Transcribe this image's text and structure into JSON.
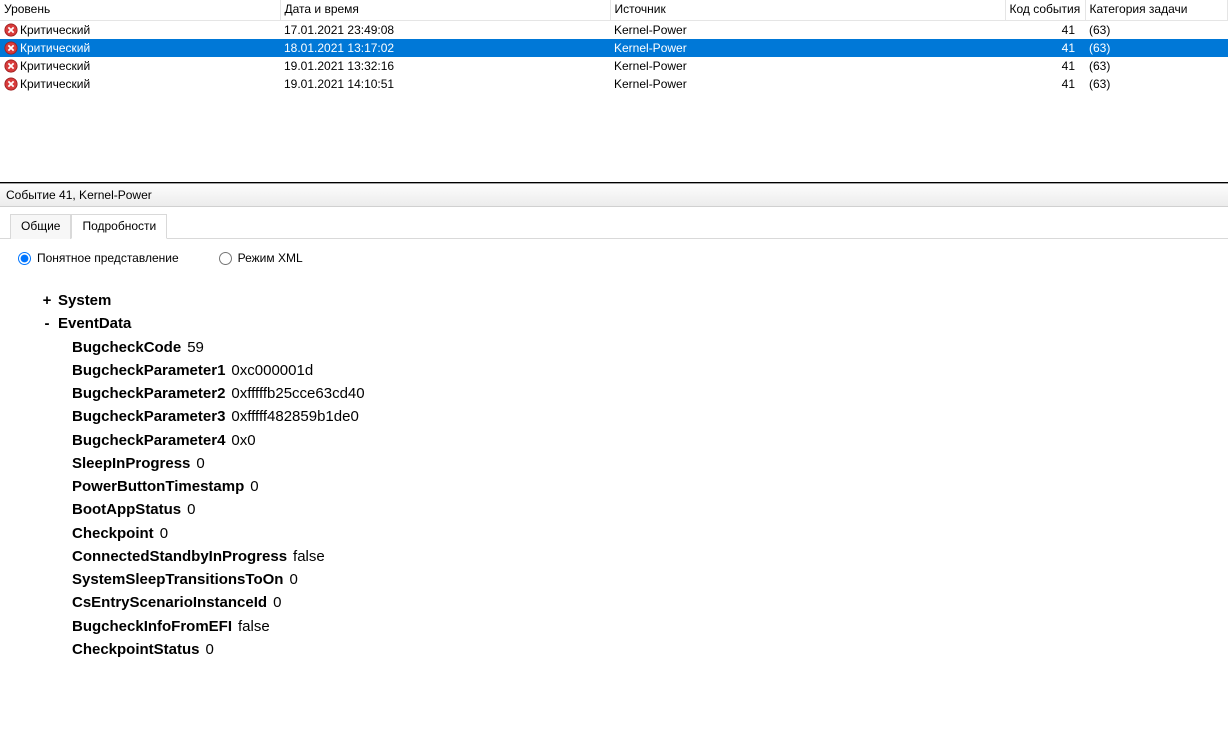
{
  "columns": {
    "level": "Уровень",
    "datetime": "Дата и время",
    "source": "Источник",
    "eventId": "Код события",
    "category": "Категория задачи"
  },
  "rows": [
    {
      "level": "Критический",
      "datetime": "17.01.2021 23:49:08",
      "source": "Kernel-Power",
      "id": "41",
      "cat": "(63)",
      "selected": false
    },
    {
      "level": "Критический",
      "datetime": "18.01.2021 13:17:02",
      "source": "Kernel-Power",
      "id": "41",
      "cat": "(63)",
      "selected": true
    },
    {
      "level": "Критический",
      "datetime": "19.01.2021 13:32:16",
      "source": "Kernel-Power",
      "id": "41",
      "cat": "(63)",
      "selected": false
    },
    {
      "level": "Критический",
      "datetime": "19.01.2021 14:10:51",
      "source": "Kernel-Power",
      "id": "41",
      "cat": "(63)",
      "selected": false
    }
  ],
  "details": {
    "title": "Событие 41, Kernel-Power",
    "tabs": {
      "general": "Общие",
      "details": "Подробности"
    },
    "radios": {
      "friendly": "Понятное представление",
      "xml": "Режим XML"
    },
    "nodes": {
      "system": "System",
      "eventData": "EventData"
    },
    "eventData": [
      {
        "k": "BugcheckCode",
        "v": "59"
      },
      {
        "k": "BugcheckParameter1",
        "v": "0xc000001d"
      },
      {
        "k": "BugcheckParameter2",
        "v": "0xfffffb25cce63cd40"
      },
      {
        "k": "BugcheckParameter3",
        "v": "0xfffff482859b1de0"
      },
      {
        "k": "BugcheckParameter4",
        "v": "0x0"
      },
      {
        "k": "SleepInProgress",
        "v": "0"
      },
      {
        "k": "PowerButtonTimestamp",
        "v": "0"
      },
      {
        "k": "BootAppStatus",
        "v": "0"
      },
      {
        "k": "Checkpoint",
        "v": "0"
      },
      {
        "k": "ConnectedStandbyInProgress",
        "v": "false"
      },
      {
        "k": "SystemSleepTransitionsToOn",
        "v": "0"
      },
      {
        "k": "CsEntryScenarioInstanceId",
        "v": "0"
      },
      {
        "k": "BugcheckInfoFromEFI",
        "v": "false"
      },
      {
        "k": "CheckpointStatus",
        "v": "0"
      }
    ]
  }
}
